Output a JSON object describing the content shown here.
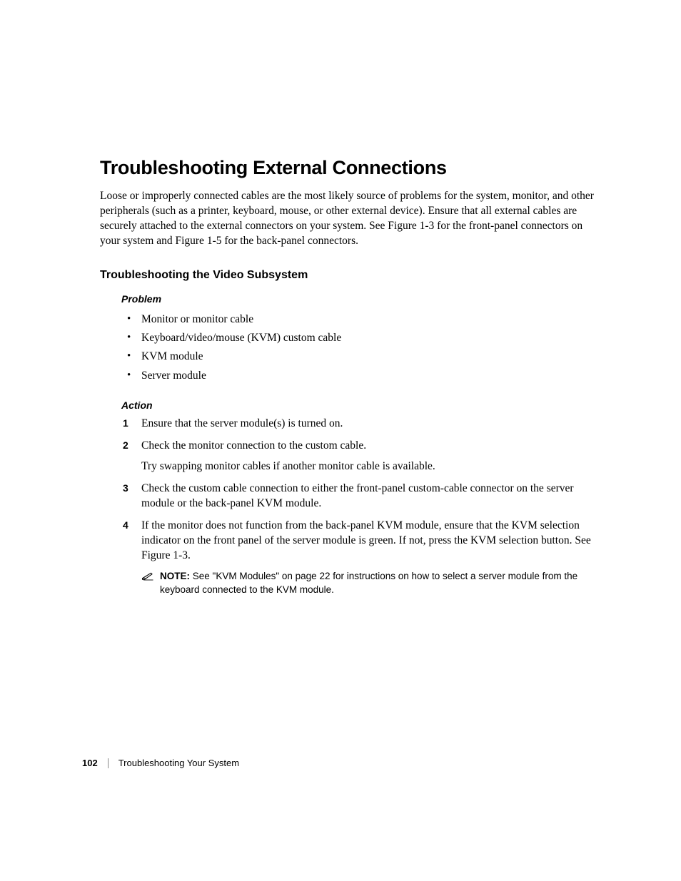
{
  "heading_main": "Troubleshooting External Connections",
  "intro_paragraph": "Loose or improperly connected cables are the most likely source of problems for the system, monitor, and other peripherals (such as a printer, keyboard, mouse, or other external device). Ensure that all external cables are securely attached to the external connectors on your system. See Figure 1-3 for the front-panel connectors on your system and Figure 1-5 for the back-panel connectors.",
  "heading_sub": "Troubleshooting the Video Subsystem",
  "heading_problem": "Problem",
  "problem_items": [
    "Monitor or monitor cable",
    "Keyboard/video/mouse (KVM) custom cable",
    "KVM module",
    "Server module"
  ],
  "heading_action": "Action",
  "action_items": {
    "1": {
      "text": "Ensure that the server module(s) is turned on."
    },
    "2": {
      "text": "Check the monitor connection to the custom cable.",
      "extra": "Try swapping monitor cables if another monitor cable is available."
    },
    "3": {
      "text": "Check the custom cable connection to either the front-panel custom-cable connector on the server module or the back-panel KVM module."
    },
    "4": {
      "text": "If the monitor does not function from the back-panel KVM module, ensure that the KVM selection indicator on the front panel of the server module is green. If not, press the KVM selection button. See Figure 1-3.",
      "note_label": "NOTE:",
      "note_text": " See \"KVM Modules\" on page 22 for instructions on how to select a server module from the keyboard connected to the KVM module."
    }
  },
  "footer": {
    "page_number": "102",
    "section_title": "Troubleshooting Your System"
  }
}
